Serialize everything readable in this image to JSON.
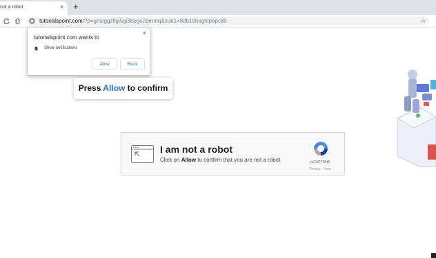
{
  "browser": {
    "tab_title": "not a robot",
    "tab_close": "×",
    "new_tab": "+",
    "back_icon": "reload-icon",
    "url_host": "tutorialspoint.com",
    "url_rest": "/?p=gmzggzlfgi5gi3bpge2dmmq&sub1=8db10heghlp8pc89",
    "bookmark_star": "☆"
  },
  "permission_popup": {
    "title": "tutorialspoint.com wants to",
    "close": "×",
    "permission": "Show notifications",
    "allow_label": "Allow",
    "block_label": "Block"
  },
  "press_bubble": {
    "prefix": "Press ",
    "allow": "Allow",
    "suffix": " to confirm"
  },
  "captcha": {
    "title": "I am not a robot",
    "sub_prefix": "Click on ",
    "sub_allow": "Allow",
    "sub_suffix": " to confirm that you are not a robot",
    "brand": "reCAPTCHA",
    "links": "Privacy - Term"
  },
  "colors": {
    "accent": "#1a73e8",
    "tabbar": "#dee1e6"
  }
}
